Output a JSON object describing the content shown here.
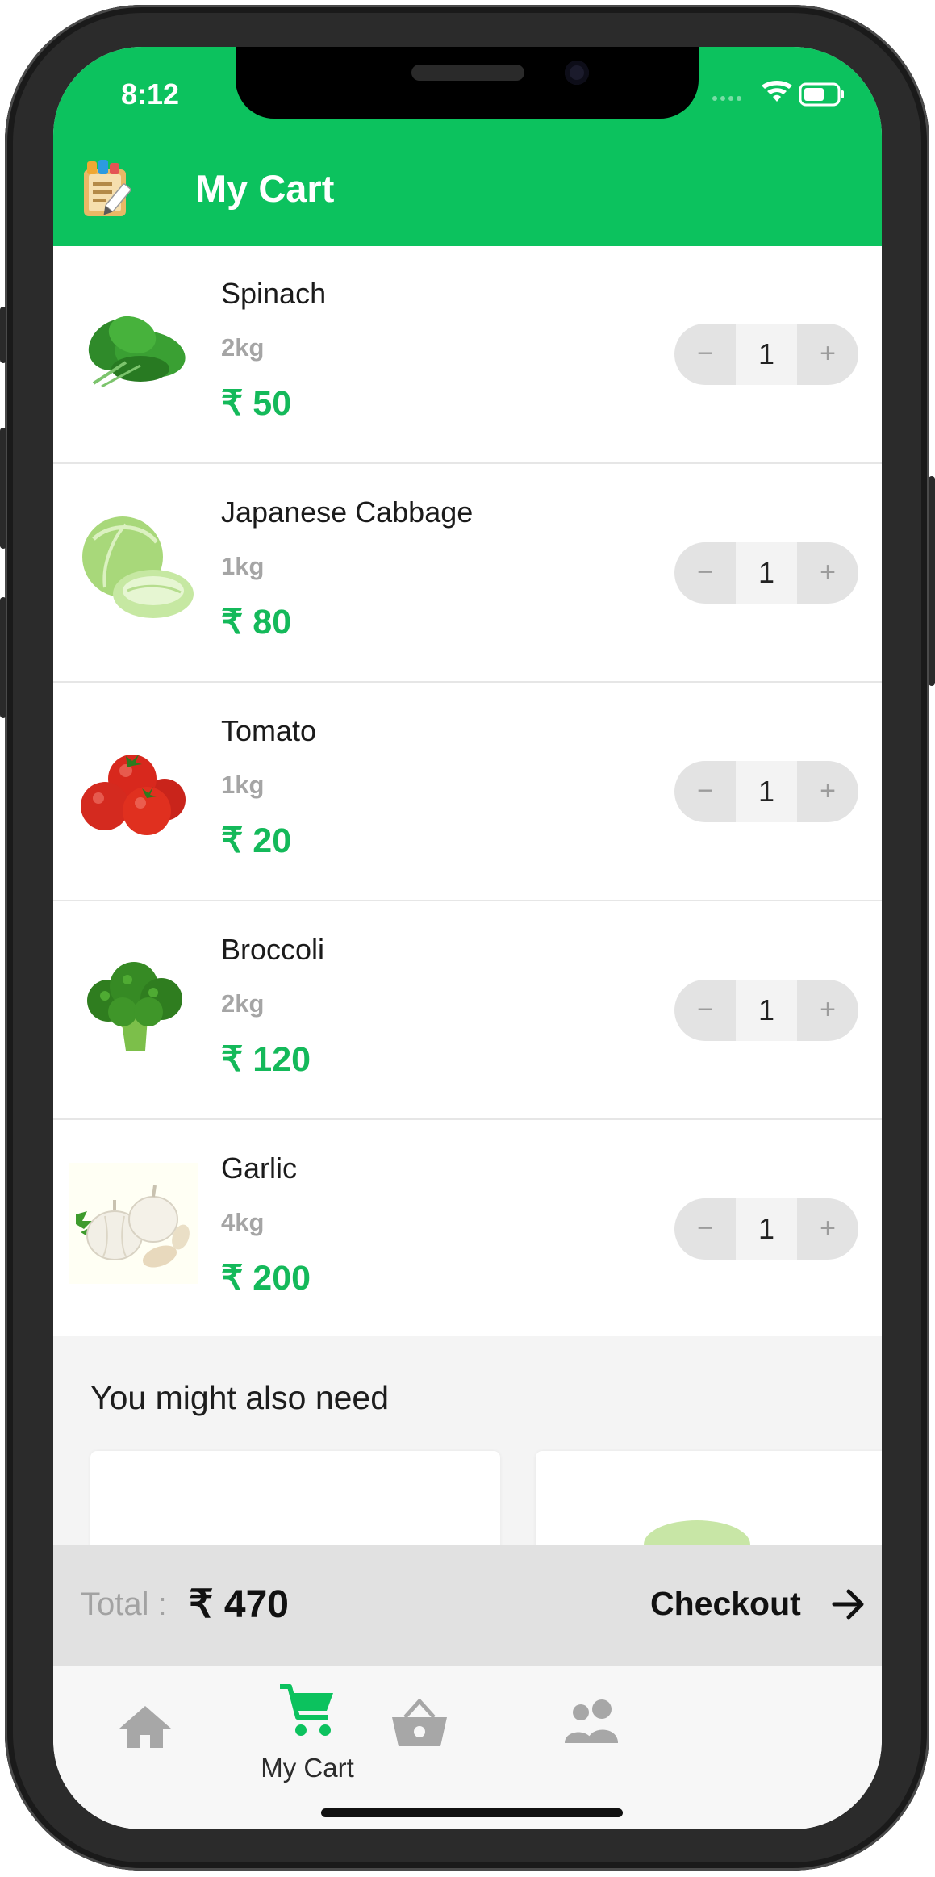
{
  "status_bar": {
    "time": "8:12"
  },
  "header": {
    "title": "My Cart"
  },
  "cart_items": [
    {
      "name": "Spinach",
      "weight": "2kg",
      "price": "₹ 50",
      "quantity": "1"
    },
    {
      "name": "Japanese Cabbage",
      "weight": "1kg",
      "price": "₹ 80",
      "quantity": "1"
    },
    {
      "name": "Tomato",
      "weight": "1kg",
      "price": "₹ 20",
      "quantity": "1"
    },
    {
      "name": "Broccoli",
      "weight": "2kg",
      "price": "₹ 120",
      "quantity": "1"
    },
    {
      "name": "Garlic",
      "weight": "4kg",
      "price": "₹ 200",
      "quantity": "1"
    }
  ],
  "stepper": {
    "minus": "−",
    "plus": "+"
  },
  "suggestions": {
    "title": "You might also need"
  },
  "summary": {
    "total_label": "Total :",
    "total_value": "₹ 470",
    "checkout_label": "Checkout"
  },
  "tabbar": {
    "active_label": "My Cart"
  },
  "colors": {
    "brand_green": "#0cc25e",
    "price_green": "#14b95a"
  },
  "icons": [
    "notes-icon",
    "spinach-image",
    "cabbage-image",
    "tomato-image",
    "broccoli-image",
    "garlic-image",
    "arrow-right-icon",
    "home-icon",
    "cart-icon",
    "basket-icon",
    "users-icon",
    "wifi-icon",
    "battery-icon"
  ]
}
